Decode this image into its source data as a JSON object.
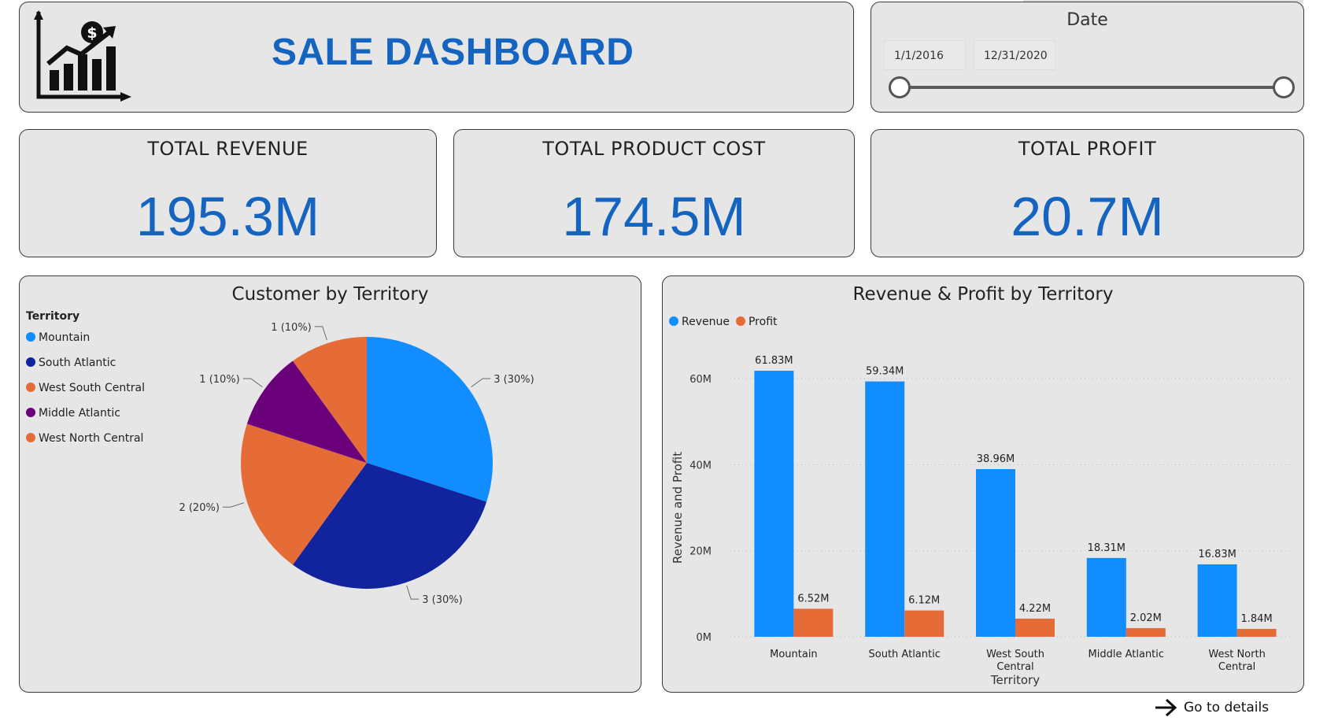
{
  "header": {
    "title": "SALE DASHBOARD",
    "logo_icon": "growth-chart-dollar-icon"
  },
  "date_slicer": {
    "title": "Date",
    "start": "1/1/2016",
    "end": "12/31/2020"
  },
  "kpis": {
    "revenue": {
      "label": "TOTAL REVENUE",
      "value": "195.3M"
    },
    "cost": {
      "label": "TOTAL PRODUCT COST",
      "value": "174.5M"
    },
    "profit": {
      "label": "TOTAL PROFIT",
      "value": "20.7M"
    }
  },
  "colors": {
    "accent": "#1565c0",
    "panel_bg": "#e6e6e6",
    "revenue": "#118dff",
    "profit": "#e66c37"
  },
  "pie": {
    "title": "Customer by Territory",
    "legend_title": "Territory"
  },
  "bar": {
    "title": "Revenue & Profit by Territory"
  },
  "footer": {
    "goto_label": "Go to details",
    "goto_icon": "arrow-right-icon"
  },
  "chart_data": [
    {
      "type": "pie",
      "title": "Customer by Territory",
      "legend_title": "Territory",
      "legend_placement": "left",
      "slices": [
        {
          "label": "Mountain",
          "value": 3,
          "display": "3 (30%)",
          "color": "#118dff"
        },
        {
          "label": "South Atlantic",
          "value": 3,
          "display": "3 (30%)",
          "color": "#12239e"
        },
        {
          "label": "West South Central",
          "value": 2,
          "display": "2 (20%)",
          "color": "#e66c37"
        },
        {
          "label": "Middle Atlantic",
          "value": 1,
          "display": "1 (10%)",
          "color": "#6b007b"
        },
        {
          "label": "West North Central",
          "value": 1,
          "display": "1 (10%)",
          "color": "#e66c37"
        }
      ]
    },
    {
      "type": "bar",
      "title": "Revenue & Profit by Territory",
      "xlabel": "Territory",
      "ylabel": "Revenue and Profit",
      "legend_placement": "top-left",
      "grid": true,
      "categories": [
        "Mountain",
        "South Atlantic",
        "West South Central",
        "Middle Atlantic",
        "West North Central"
      ],
      "category_lines": [
        [
          "Mountain"
        ],
        [
          "South Atlantic"
        ],
        [
          "West South",
          "Central"
        ],
        [
          "Middle Atlantic"
        ],
        [
          "West North",
          "Central"
        ]
      ],
      "yticks": [
        0,
        20,
        40,
        60
      ],
      "ytick_labels": [
        "0M",
        "20M",
        "40M",
        "60M"
      ],
      "ylim": [
        0,
        65
      ],
      "series": [
        {
          "name": "Revenue",
          "color": "#118dff",
          "values": [
            61.83,
            59.34,
            38.96,
            18.31,
            16.83
          ],
          "labels": [
            "61.83M",
            "59.34M",
            "38.96M",
            "18.31M",
            "16.83M"
          ]
        },
        {
          "name": "Profit",
          "color": "#e66c37",
          "values": [
            6.52,
            6.12,
            4.22,
            2.02,
            1.84
          ],
          "labels": [
            "6.52M",
            "6.12M",
            "4.22M",
            "2.02M",
            "1.84M"
          ]
        }
      ]
    }
  ]
}
